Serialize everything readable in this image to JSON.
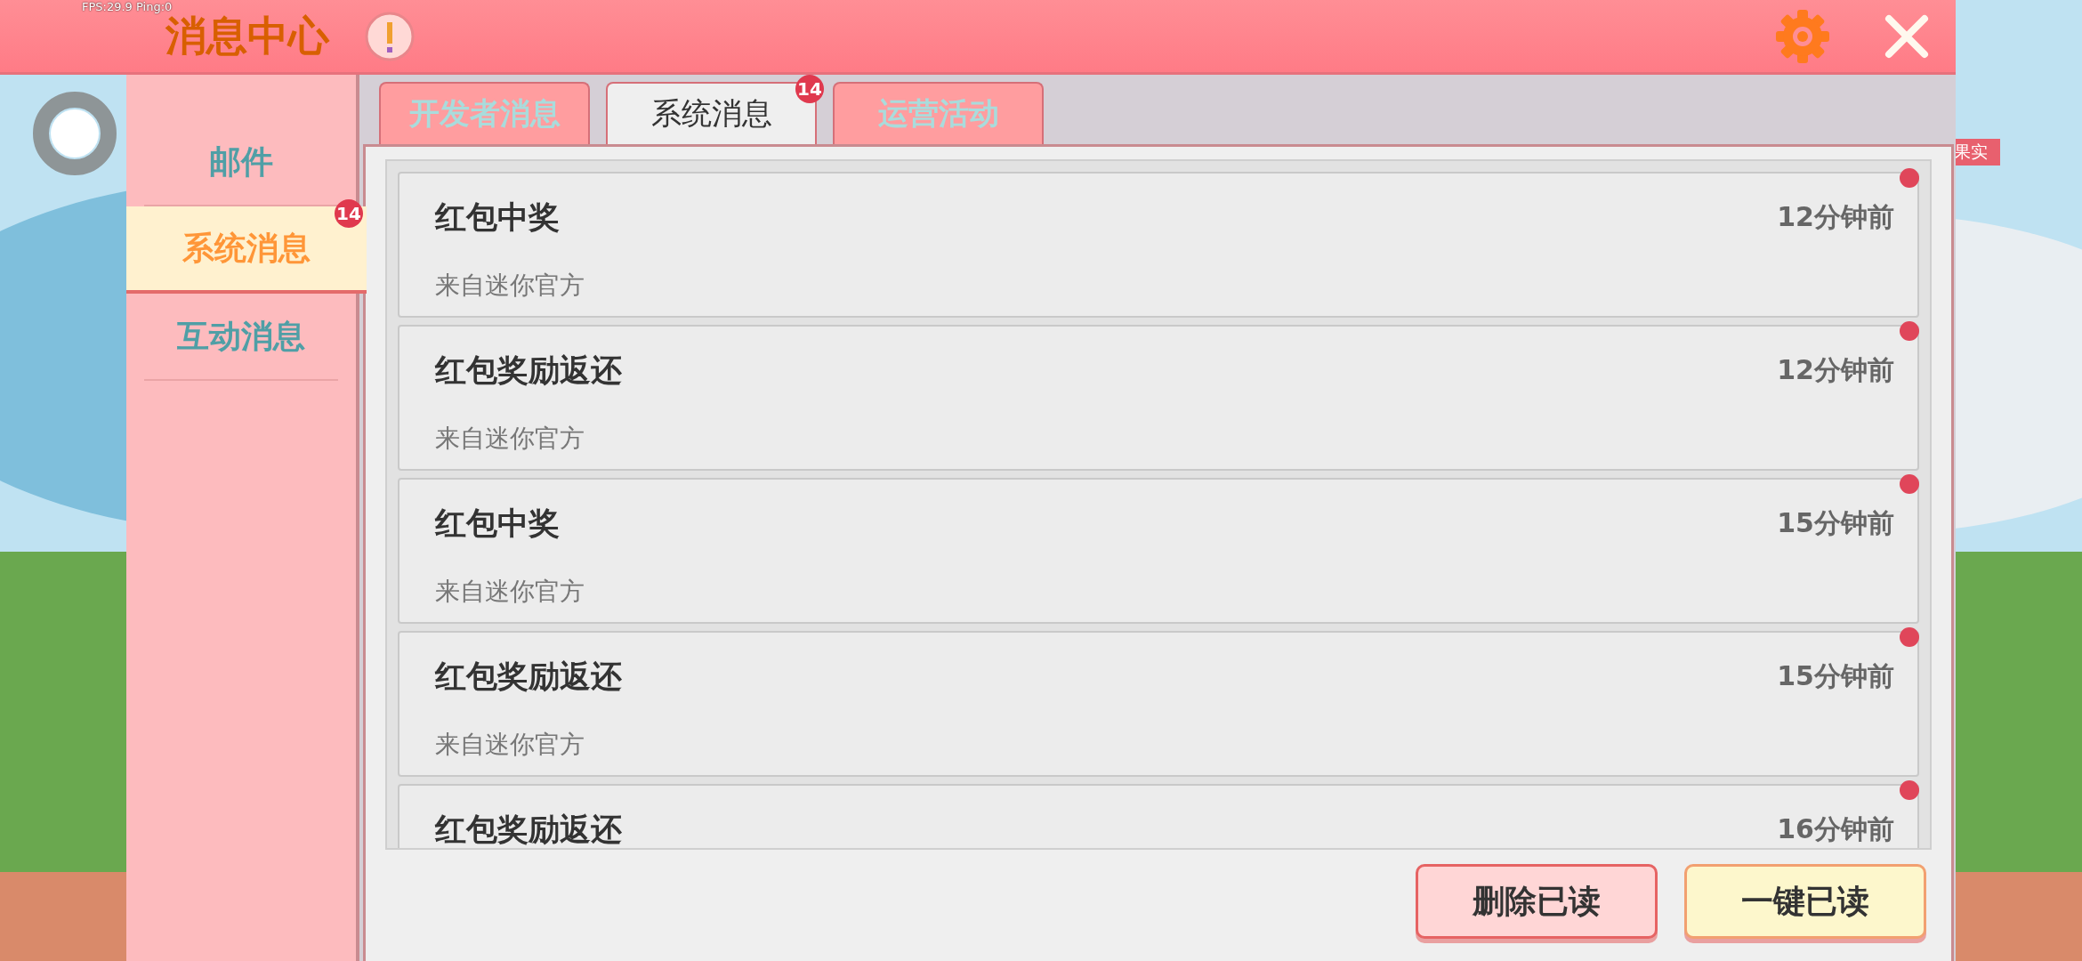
{
  "overlay": {
    "stats": "FPS:29.9  Ping:0",
    "side_label": "果实"
  },
  "header": {
    "title": "消息中心"
  },
  "sidebar": {
    "items": [
      {
        "label": "邮件",
        "selected": false
      },
      {
        "label": "系统消息",
        "selected": true,
        "badge": "14"
      },
      {
        "label": "互动消息",
        "selected": false
      }
    ]
  },
  "tabs": [
    {
      "label": "开发者消息",
      "selected": false
    },
    {
      "label": "系统消息",
      "selected": true,
      "badge": "14"
    },
    {
      "label": "运营活动",
      "selected": false
    }
  ],
  "messages": [
    {
      "title": "红包中奖",
      "time": "12分钟前",
      "source": "来自迷你官方",
      "unread": true
    },
    {
      "title": "红包奖励返还",
      "time": "12分钟前",
      "source": "来自迷你官方",
      "unread": true
    },
    {
      "title": "红包中奖",
      "time": "15分钟前",
      "source": "来自迷你官方",
      "unread": true
    },
    {
      "title": "红包奖励返还",
      "time": "15分钟前",
      "source": "来自迷你官方",
      "unread": true
    },
    {
      "title": "红包奖励返还",
      "time": "16分钟前",
      "unread": true
    }
  ],
  "buttons": [
    {
      "label": "删除已读",
      "kind": "danger"
    },
    {
      "label": "一键已读",
      "kind": "primary"
    }
  ]
}
